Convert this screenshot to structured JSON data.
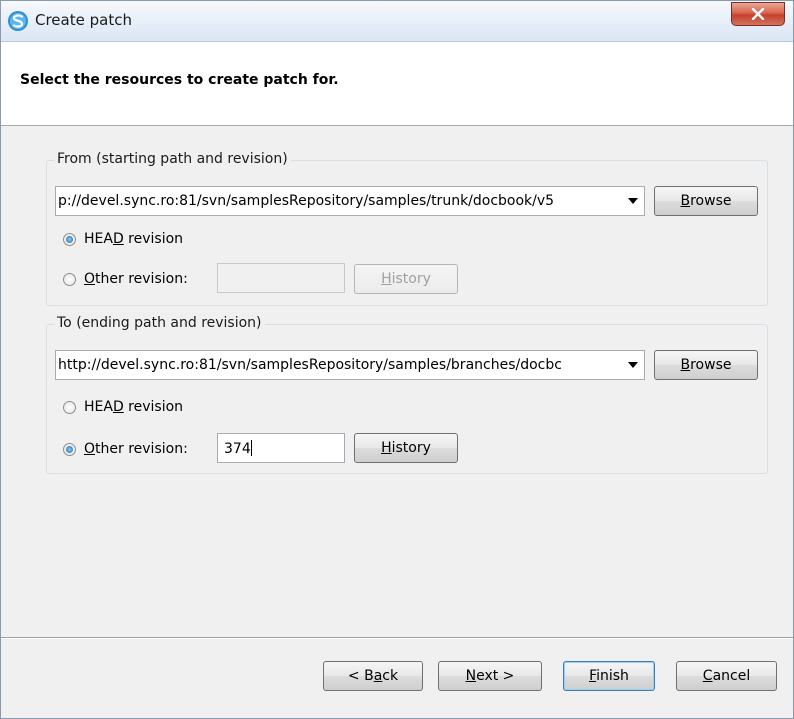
{
  "window": {
    "title": "Create patch",
    "close_label": "X"
  },
  "header": {
    "text": "Select the resources to create patch for."
  },
  "from_group": {
    "legend": "From (starting path and revision)",
    "path_value": "p://devel.sync.ro:81/svn/samplesRepository/samples/trunk/docbook/v5",
    "browse_pre": "",
    "browse_mnemonic": "B",
    "browse_post": "rowse",
    "head_pre": "HEA",
    "head_mnemonic": "D",
    "head_post": " revision",
    "head_checked": true,
    "other_pre": "",
    "other_mnemonic": "O",
    "other_post": "ther revision:",
    "other_checked": false,
    "revision_value": "",
    "history_mnemonic": "H",
    "history_post": "istory",
    "history_enabled": false
  },
  "to_group": {
    "legend": "To (ending path and revision)",
    "path_value": "http://devel.sync.ro:81/svn/samplesRepository/samples/branches/docbc",
    "browse_mnemonic": "B",
    "browse_post": "rowse",
    "head_pre": "HEA",
    "head_mnemonic": "D",
    "head_post": " revision",
    "head_checked": false,
    "other_mnemonic": "O",
    "other_post": "ther revision:",
    "other_checked": true,
    "revision_value": "374",
    "history_mnemonic": "H",
    "history_post": "istory",
    "history_enabled": true
  },
  "footer": {
    "back_pre": "< B",
    "back_mnemonic": "a",
    "back_post": "ck",
    "next_mnemonic": "N",
    "next_post": "ext >",
    "finish_mnemonic": "F",
    "finish_post": "inish",
    "cancel_mnemonic": "C",
    "cancel_post": "ancel"
  },
  "colors": {
    "accent": "#3c7fb1",
    "close_red": "#c6412c"
  }
}
